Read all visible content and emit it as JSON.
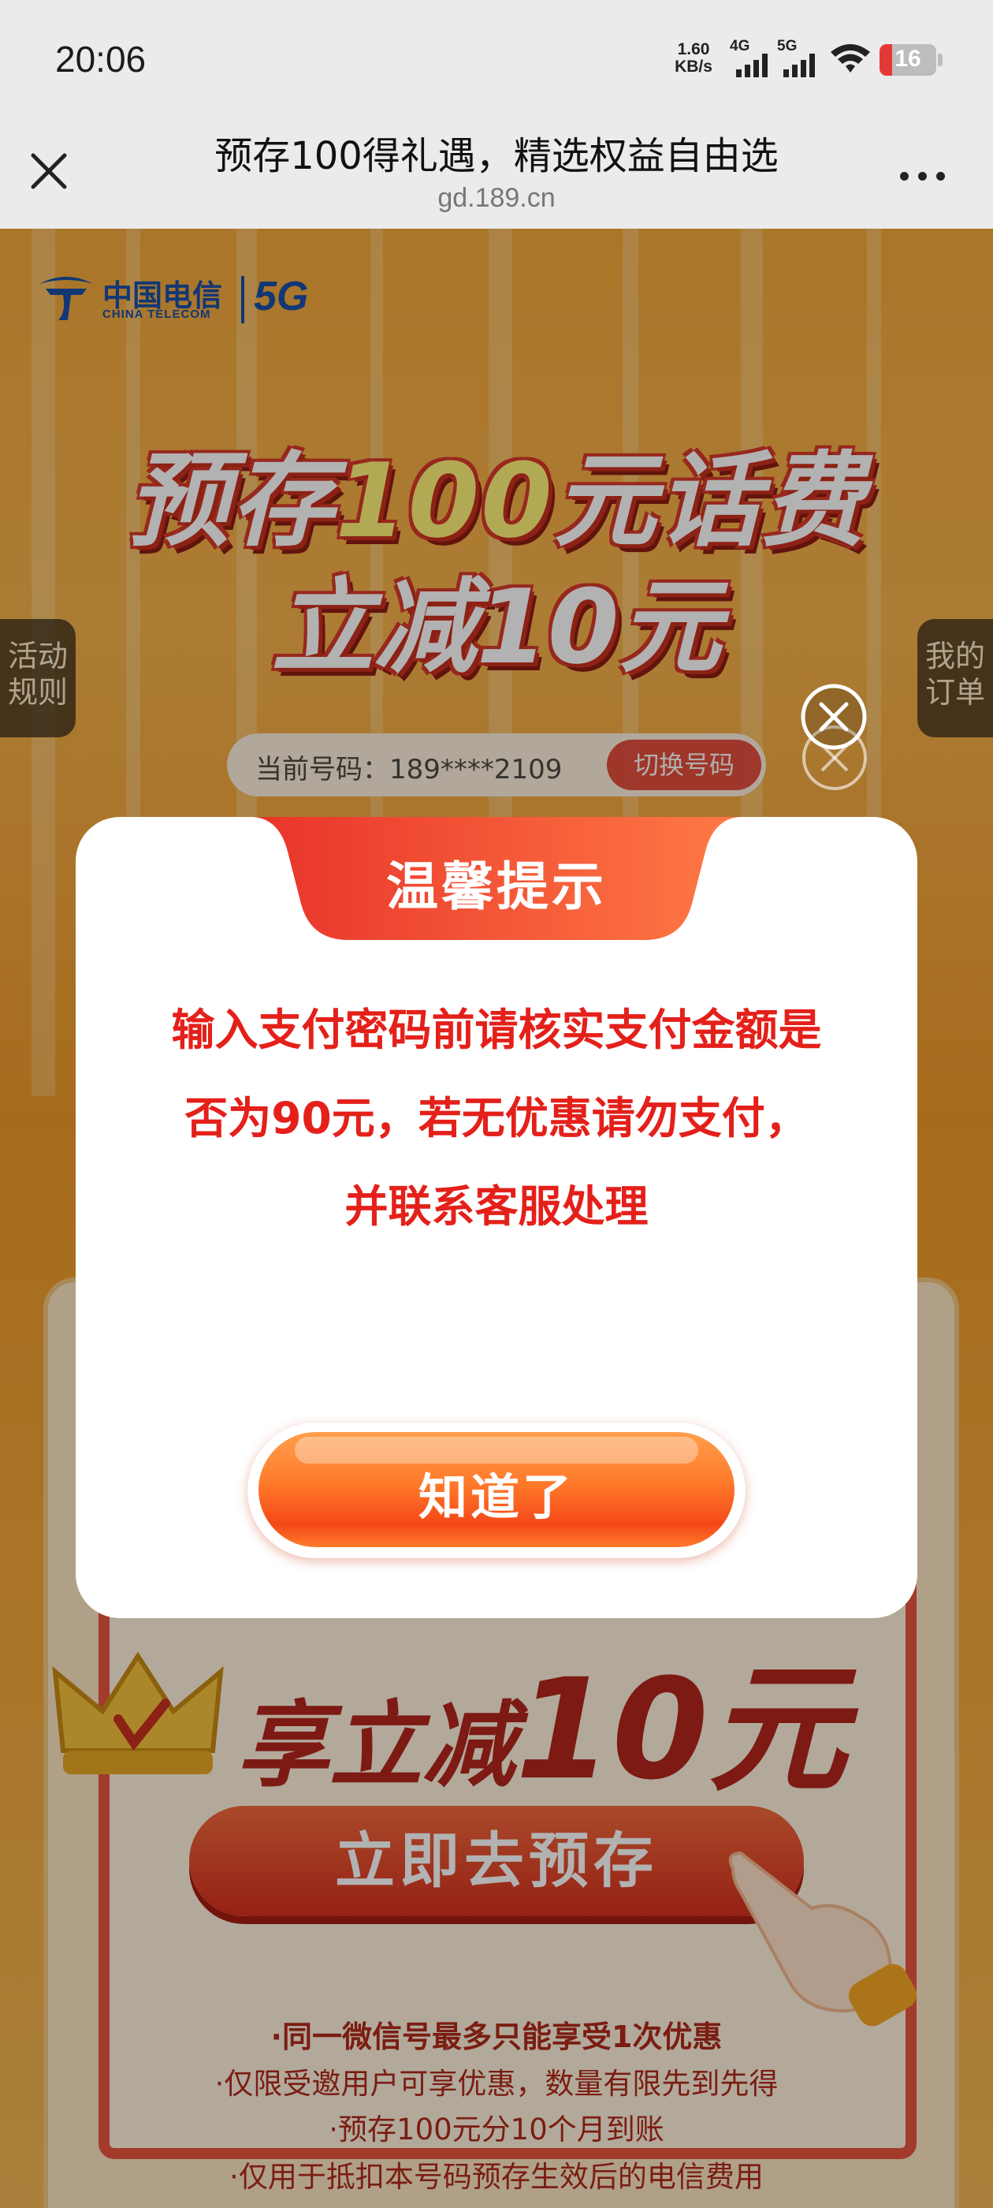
{
  "status_bar": {
    "time": "20:06",
    "net_speed_value": "1.60",
    "net_speed_unit": "KB/s",
    "signal_1": "4G",
    "signal_2": "5G",
    "battery": "16"
  },
  "title_bar": {
    "title": "预存100得礼遇，精选权益自由选",
    "url": "gd.189.cn"
  },
  "page": {
    "logo_cn": "中国电信",
    "logo_en": "CHINA TELECOM",
    "logo_5g": "5G",
    "hero_line1_a": "预存",
    "hero_line1_b": "100",
    "hero_line1_c": "元话费",
    "hero_line2": "立减10元",
    "side_left": "活动规则",
    "side_right": "我的订单",
    "current_number": "当前号码：189****2109",
    "switch_number": "切换号码",
    "enjoy_a": "享立减",
    "enjoy_b": "10元",
    "go_button": "立即去预存",
    "rules": [
      "·同一微信号最多只能享受1次优惠",
      "·仅限受邀用户可享优惠，数量有限先到先得",
      "·预存100元分10个月到账",
      "·仅用于抵扣本号码预存生效后的电信费用"
    ]
  },
  "modal": {
    "title": "温馨提示",
    "message_line1": "输入支付密码前请核实支付金额是",
    "message_line2": "否为90元，若无优惠请勿支付，",
    "message_line3": "并联系客服处理",
    "ok_button": "知道了"
  },
  "colors": {
    "accent_red": "#e4201a",
    "tab_gradient_start": "#e8332a",
    "tab_gradient_end": "#ff7a45",
    "page_orange": "#f4a93b"
  }
}
